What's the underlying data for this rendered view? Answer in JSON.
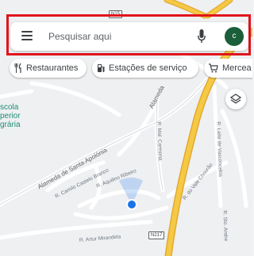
{
  "search": {
    "placeholder": "Pesquisar aqui",
    "avatar_letter": "c"
  },
  "chips": [
    {
      "label": "Restaurantes",
      "icon": "fork-knife-icon"
    },
    {
      "label": "Estações de serviço",
      "icon": "fuel-pump-icon"
    },
    {
      "label": "Mercea",
      "icon": "shopping-cart-icon"
    }
  ],
  "map": {
    "poi_lines": [
      "scola",
      "perior",
      "grária"
    ],
    "streets": {
      "santa_apolonia": "Alameda de Santa Apolónia",
      "alameda_top": "Alameda",
      "castelo_branco": "R. Camilo Castelo Branco",
      "aquilino": "R. Aquilino Ribeiro",
      "mal_carmona": "R. Mal. Carmona",
      "leite_vasconcelos": "R. Leite de Vasconcelos",
      "vale_chourao": "R. do Vale Chourão",
      "sto_andre": "R. Sto. Andre",
      "artur_mirandela": "R. Artur Mirandela"
    },
    "shields": {
      "top": "N15",
      "bottom": "N217"
    }
  },
  "colors": {
    "highlight": "#e1141b",
    "road_major": "#f6c945",
    "road_major_edge": "#e3a92f",
    "location_dot": "#1a73e8",
    "poi_text": "#1e8e76"
  }
}
